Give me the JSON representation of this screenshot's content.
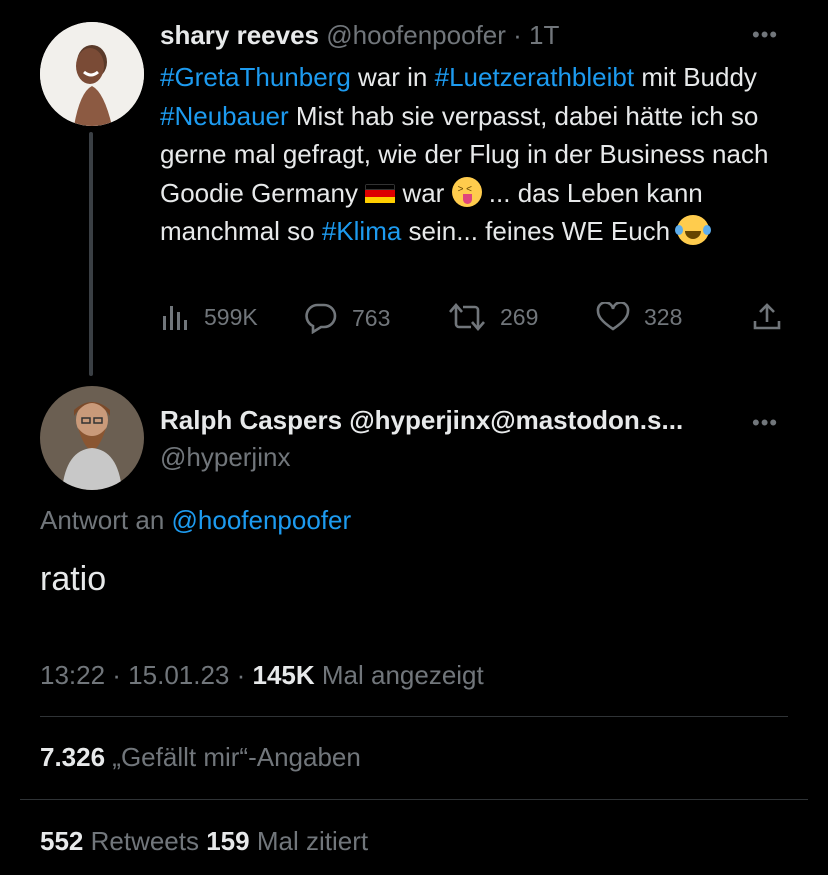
{
  "original_tweet": {
    "author_name": "shary reeves",
    "author_handle": "@hoofenpoofer",
    "time": "· 1T",
    "text_parts": {
      "tag_greta": "#GretaThunberg",
      "t1": " war in ",
      "tag_luetzi": "#Luetzerathbleibt",
      "t2": " mit Buddy ",
      "tag_neubauer": "#Neubauer",
      "t3": " Mist hab sie verpasst, dabei hätte ich so gerne mal gefragt, wie der Flug in der Business nach Goodie Germany ",
      "t4": " war ",
      "t5": "... das Leben kann manchmal so ",
      "tag_klima": "#Klima",
      "t6": " sein... feines WE Euch "
    },
    "views": "599K",
    "replies": "763",
    "retweets": "269",
    "likes": "328",
    "more_icon": "more-dots-icon"
  },
  "reply_tweet": {
    "author_name": "Ralph Caspers @hyperjinx@mastodon.s...",
    "author_handle": "@hyperjinx",
    "reply_to_prefix": "Antwort an ",
    "reply_to_handle": "@hoofenpoofer",
    "text": "ratio",
    "time": "13:22 · 15.01.23 · ",
    "views_count": "145K",
    "views_label": " Mal angezeigt",
    "likes_count": "7.326",
    "likes_label": " „Gefällt mir“-Angaben",
    "retweets_count": "552",
    "retweets_label": " Retweets ",
    "quotes_count": "159",
    "quotes_label": " Mal zitiert"
  },
  "colors": {
    "background": "#000000",
    "text": "#e7e9ea",
    "muted": "#71767b",
    "accent": "#1d9bf0",
    "divider": "#2f3336"
  },
  "icons": [
    "views-bar-icon",
    "reply-bubble-icon",
    "retweet-icon",
    "like-heart-icon",
    "share-upload-icon",
    "german-flag-emoji",
    "tongue-wink-emoji",
    "tears-of-joy-emoji"
  ]
}
